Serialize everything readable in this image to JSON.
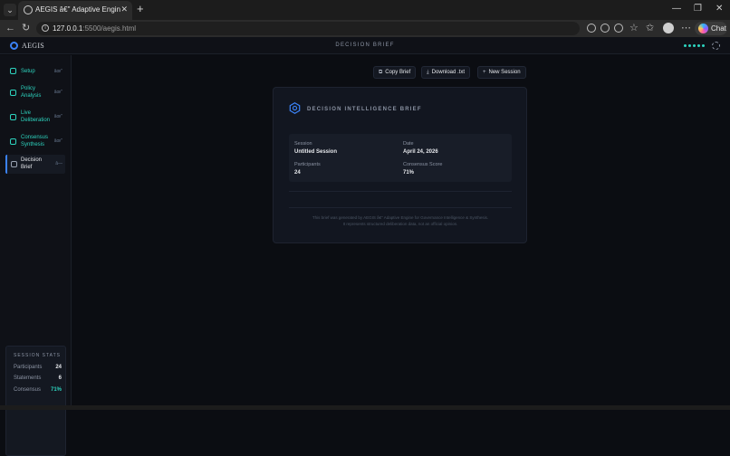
{
  "browser": {
    "tab_title": "AEGIS â€\" Adaptive Engine for Governance",
    "url_host": "127.0.0.1",
    "url_path": ":5500/aegis.html",
    "chat_label": "Chat",
    "new_tab_glyph": "+",
    "close_glyph": "✕",
    "minimize_glyph": "—",
    "restore_glyph": "❐",
    "window_close_glyph": "✕",
    "tab_menu_glyph": "⌄",
    "back_glyph": "←",
    "forward_glyph": "→",
    "reload_glyph": "↻",
    "more_glyph": "⋯",
    "star_glyph": "☆",
    "favorites_glyph": "✩",
    "info_glyph": "i"
  },
  "app": {
    "logo_text": "AEGIS",
    "header_title": "DECISION BRIEF",
    "accent": "#3b82f6",
    "teal": "#2dd4bf"
  },
  "sidebar": {
    "items": [
      {
        "label": "Setup",
        "check": "âœ\""
      },
      {
        "label": "Policy Analysis",
        "check": "âœ\""
      },
      {
        "label": "Live Deliberation",
        "check": "âœ\""
      },
      {
        "label": "Consensus Synthesis",
        "check": "âœ\""
      },
      {
        "label": "Decision Brief",
        "check": "â—"
      }
    ],
    "stats": {
      "title": "SESSION STATS",
      "rows": [
        {
          "label": "Participants",
          "value": "24"
        },
        {
          "label": "Statements",
          "value": "6"
        },
        {
          "label": "Consensus",
          "value": "71%"
        }
      ]
    }
  },
  "actions": {
    "copy": "Copy Brief",
    "download": "Download .txt",
    "new_session": "New Session",
    "copy_icon": "⧉",
    "download_icon": "⤓",
    "new_icon": "+"
  },
  "brief": {
    "title": "DECISION INTELLIGENCE BRIEF",
    "session_label": "Session",
    "session_value": "Untitled Session",
    "date_label": "Date",
    "date_value": "April 24, 2026",
    "participants_label": "Participants",
    "participants_value": "24",
    "consensus_label": "Consensus Score",
    "consensus_value": "71%",
    "footnote_line1": "This brief was generated by AEGIS â€\" Adaptive Engine for Governance Intelligence & Synthesis.",
    "footnote_line2": "It represents structured deliberation data, not an official opinion."
  }
}
